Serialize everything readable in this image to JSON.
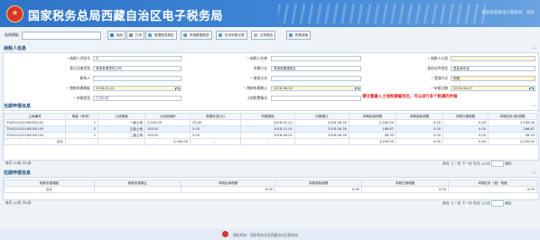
{
  "header": {
    "title": "国家税务总局西藏自治区电子税务局",
    "welcome": "欢迎您登录电子税务局，您好"
  },
  "toolbar": {
    "label": "选择模板",
    "select_value": "",
    "buttons": [
      "保存",
      "打印",
      "数据核查报告",
      "申报数据核查",
      "历次申报记录",
      "已有报告",
      "税费减免"
    ]
  },
  "taxpayer": {
    "title": "纳税人信息",
    "fields": [
      {
        "label": "纳税人识别号",
        "value": "D",
        "required": true
      },
      {
        "label": "纳税人名称",
        "value": "",
        "required": true
      },
      {
        "label": "纳税人分类",
        "value": "",
        "required": true,
        "hl": true
      },
      {
        "label": "登记注册类型",
        "value": "其他有限责任公司",
        "required": false
      },
      {
        "label": "所属行业",
        "value": "其他房屋建筑业",
        "required": false
      },
      {
        "label": "身份证件类型",
        "value": "居民身份证",
        "required": false
      },
      {
        "label": "联系人",
        "value": "",
        "required": false
      },
      {
        "label": "联系方式",
        "value": "",
        "required": true
      },
      {
        "label": "受理方式",
        "value": "网络",
        "required": true
      },
      {
        "label": "税款所属期起",
        "value": "2018-01-01",
        "required": true,
        "hl": true,
        "cal": true
      },
      {
        "label": "税款所属期止",
        "value": "2018-06-30",
        "required": true,
        "hl": true,
        "cal": true
      },
      {
        "label": "申报日期",
        "value": "2018-06-07",
        "required": true,
        "hl": true,
        "cal": true
      },
      {
        "label": "申报类型",
        "value": "正常申报",
        "required": true
      },
      {
        "label": "土地税费情况",
        "value": "",
        "required": false
      }
    ],
    "warning": "请注意输入土地税源编号后，可以进行多个税源的申报"
  },
  "current": {
    "title": "当期申报信息",
    "columns": [
      "土地编号",
      "等级（标号）",
      "土地等级",
      "土地总面积",
      "税额标准(元)",
      "所属期起",
      "所属期止",
      "本期应纳税额",
      "本期减免税额",
      "本期已缴税额",
      "本期应补(退)税额"
    ],
    "rows": [
      [
        "T54010220180000142",
        "1",
        "一级土地",
        "2,500.00",
        "20.00",
        "2018-01-01",
        "2018-06-30",
        "2,500.00",
        "0.00",
        "0.00",
        "2,500.00"
      ],
      [
        "T54010220180000145",
        "2",
        "五级土地",
        "100.00",
        "5.00",
        "2018-01-01",
        "2018-06-30",
        "166.67",
        "0.00",
        "0.00",
        "166.67"
      ],
      [
        "T54010220180000144",
        "1",
        "二级土地",
        "100.00",
        "5.00",
        "2018-06-01",
        "2018-06-30",
        "58.33",
        "0.00",
        "0.00",
        "58.33"
      ],
      [
        "合计",
        "",
        "",
        "3,500.00",
        "-",
        "-",
        "-",
        "3,250.00",
        "0.00",
        "0.00",
        "3,250.00"
      ]
    ],
    "pager": "每页 20条 共3条",
    "nav": [
      "首页",
      "上一页",
      "下一页",
      "末页",
      "1/1页",
      "确定"
    ]
  },
  "previous": {
    "title": "往期申报信息",
    "columns": [
      "税款所属期起",
      "税款所属期止",
      "本期应纳税额",
      "本期减免税额",
      "本期已缴税额",
      "本期应补（退）税额"
    ],
    "rows": [
      [
        "合计",
        "",
        "0.00",
        "0.00",
        "0.00",
        "0.00"
      ]
    ],
    "pager": "每页 20条 共0条",
    "nav": [
      "首页",
      "上一页",
      "下一页",
      "末页",
      "1/1页",
      "确定"
    ]
  },
  "footer": {
    "text": "版权所有：国家税务总局西藏自治区税务局"
  },
  "colors": {
    "header": "#2f73c7",
    "required": "#d8342b",
    "warning": "#e02020",
    "highlight_field": "#fdf6d5"
  }
}
